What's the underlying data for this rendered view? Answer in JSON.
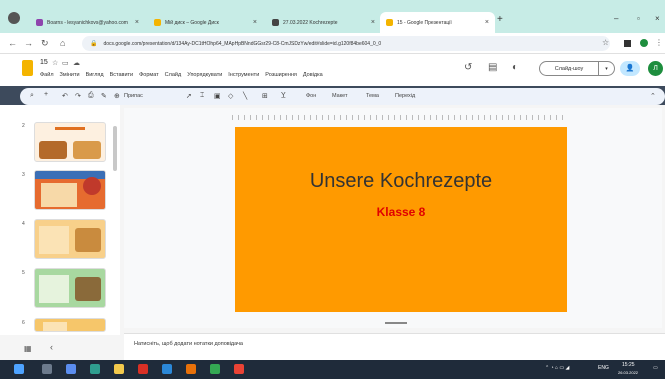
{
  "browser": {
    "tabs": [
      {
        "label": "Boarns - lesyanichkovs@yahoo.com",
        "color": "#8e44ad"
      },
      {
        "label": "Мій диск – Google Диск",
        "color": "#f4b400"
      },
      {
        "label": "27.03.2022 Kochrezepte",
        "color": "#444444"
      },
      {
        "label": "15 - Google Презентації",
        "color": "#f4b400"
      }
    ],
    "url": "docs.google.com/presentation/d/134Ay-DC1tHOhp64_MApHpBNndGGsr29-C8-CmJSDzYw/edit#slide=id.g120f84be604_0_0"
  },
  "doc": {
    "title": "15",
    "menus": [
      "Файл",
      "Змінити",
      "Вигляд",
      "Вставити",
      "Формат",
      "Слайд",
      "Упорядкувати",
      "Інструменти",
      "Розширення",
      "Довідка"
    ],
    "slideshow_label": "Слайд-шоу",
    "avatar_letter": "Л"
  },
  "toolbar": {
    "fit_label": "Припас",
    "background_label": "Фон",
    "layout_label": "Макет",
    "theme_label": "Тема",
    "transition_label": "Перехід"
  },
  "filmstrip": {
    "slides": [
      {
        "num": "2",
        "bg": "#fdf0e0"
      },
      {
        "num": "3",
        "bg": "#e66b2f"
      },
      {
        "num": "4",
        "bg": "#f8d08a"
      },
      {
        "num": "5",
        "bg": "#a8d8a0"
      },
      {
        "num": "6",
        "bg": "#f6c66a"
      }
    ]
  },
  "slide": {
    "title": "Unsere Kochrezepte",
    "subtitle": "Klasse 8",
    "bg_color": "#ff9a00",
    "subtitle_color": "#e00000"
  },
  "notes": {
    "placeholder": "Натисніть, щоб додати нотатки доповідача"
  },
  "taskbar": {
    "lang": "ENG",
    "time": "15:25",
    "date": "26.03.2022"
  }
}
